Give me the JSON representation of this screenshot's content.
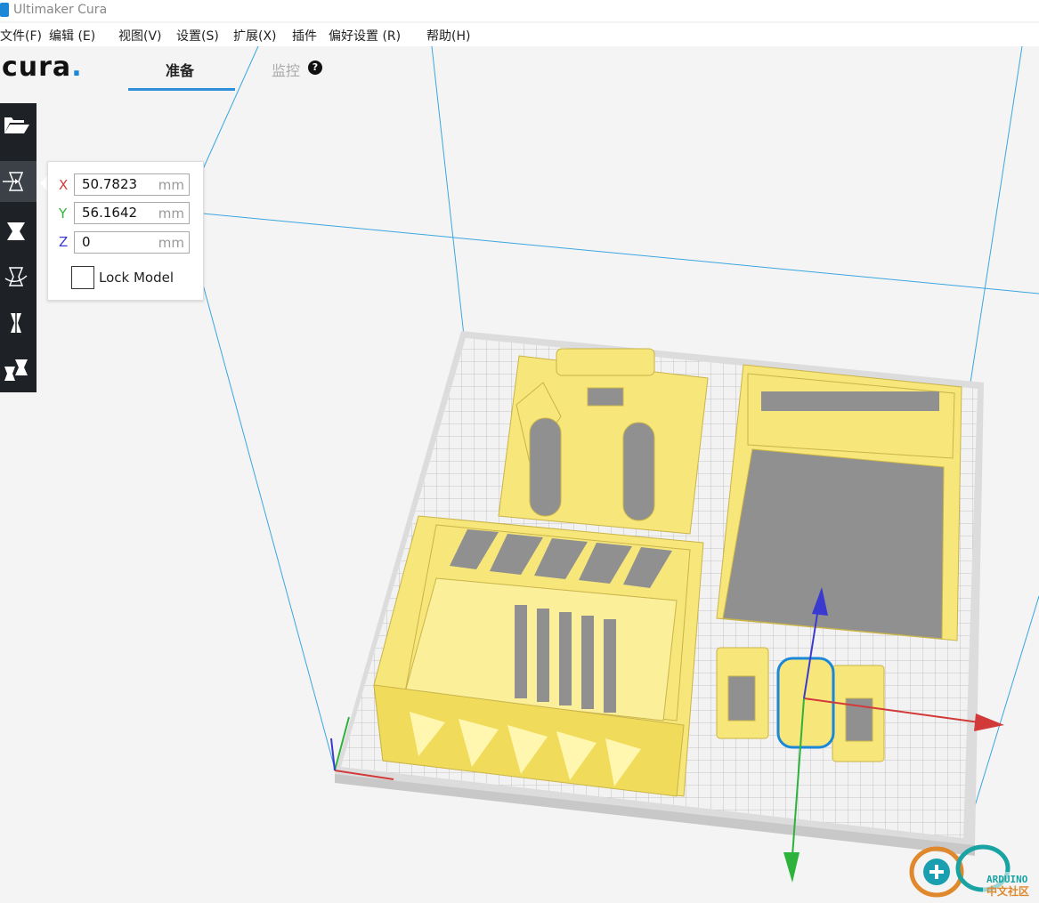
{
  "window": {
    "title": "Ultimaker Cura"
  },
  "menu": [
    {
      "label": "文件(F)"
    },
    {
      "label": "编辑 (E)"
    },
    {
      "label": "视图(V)"
    },
    {
      "label": "设置(S)"
    },
    {
      "label": "扩展(X)"
    },
    {
      "label": "插件"
    },
    {
      "label": "偏好设置 (R)"
    },
    {
      "label": "帮助(H)"
    }
  ],
  "header": {
    "logo": "cura",
    "logo_dot": ".",
    "tabs": [
      {
        "label": "准备"
      },
      {
        "label": "监控"
      }
    ],
    "help_glyph": "?"
  },
  "toolbar": {
    "tools": [
      "open-file-icon",
      "move-icon",
      "scale-icon",
      "rotate-icon",
      "mirror-icon",
      "per-model-settings-icon"
    ]
  },
  "move_panel": {
    "x": {
      "label": "X",
      "value": "50.7823",
      "unit": "mm"
    },
    "y": {
      "label": "Y",
      "value": "56.1642",
      "unit": "mm"
    },
    "z": {
      "label": "Z",
      "value": "0",
      "unit": "mm"
    },
    "lock_label": "Lock Model"
  },
  "badge": {
    "line1": "ARDUINO",
    "line2": "中文社区"
  },
  "colors": {
    "accent": "#2e8fd8",
    "model": "#f7e67a",
    "x_axis": "#d23a3a",
    "y_axis": "#2db33c",
    "z_axis": "#3a3ad0"
  }
}
